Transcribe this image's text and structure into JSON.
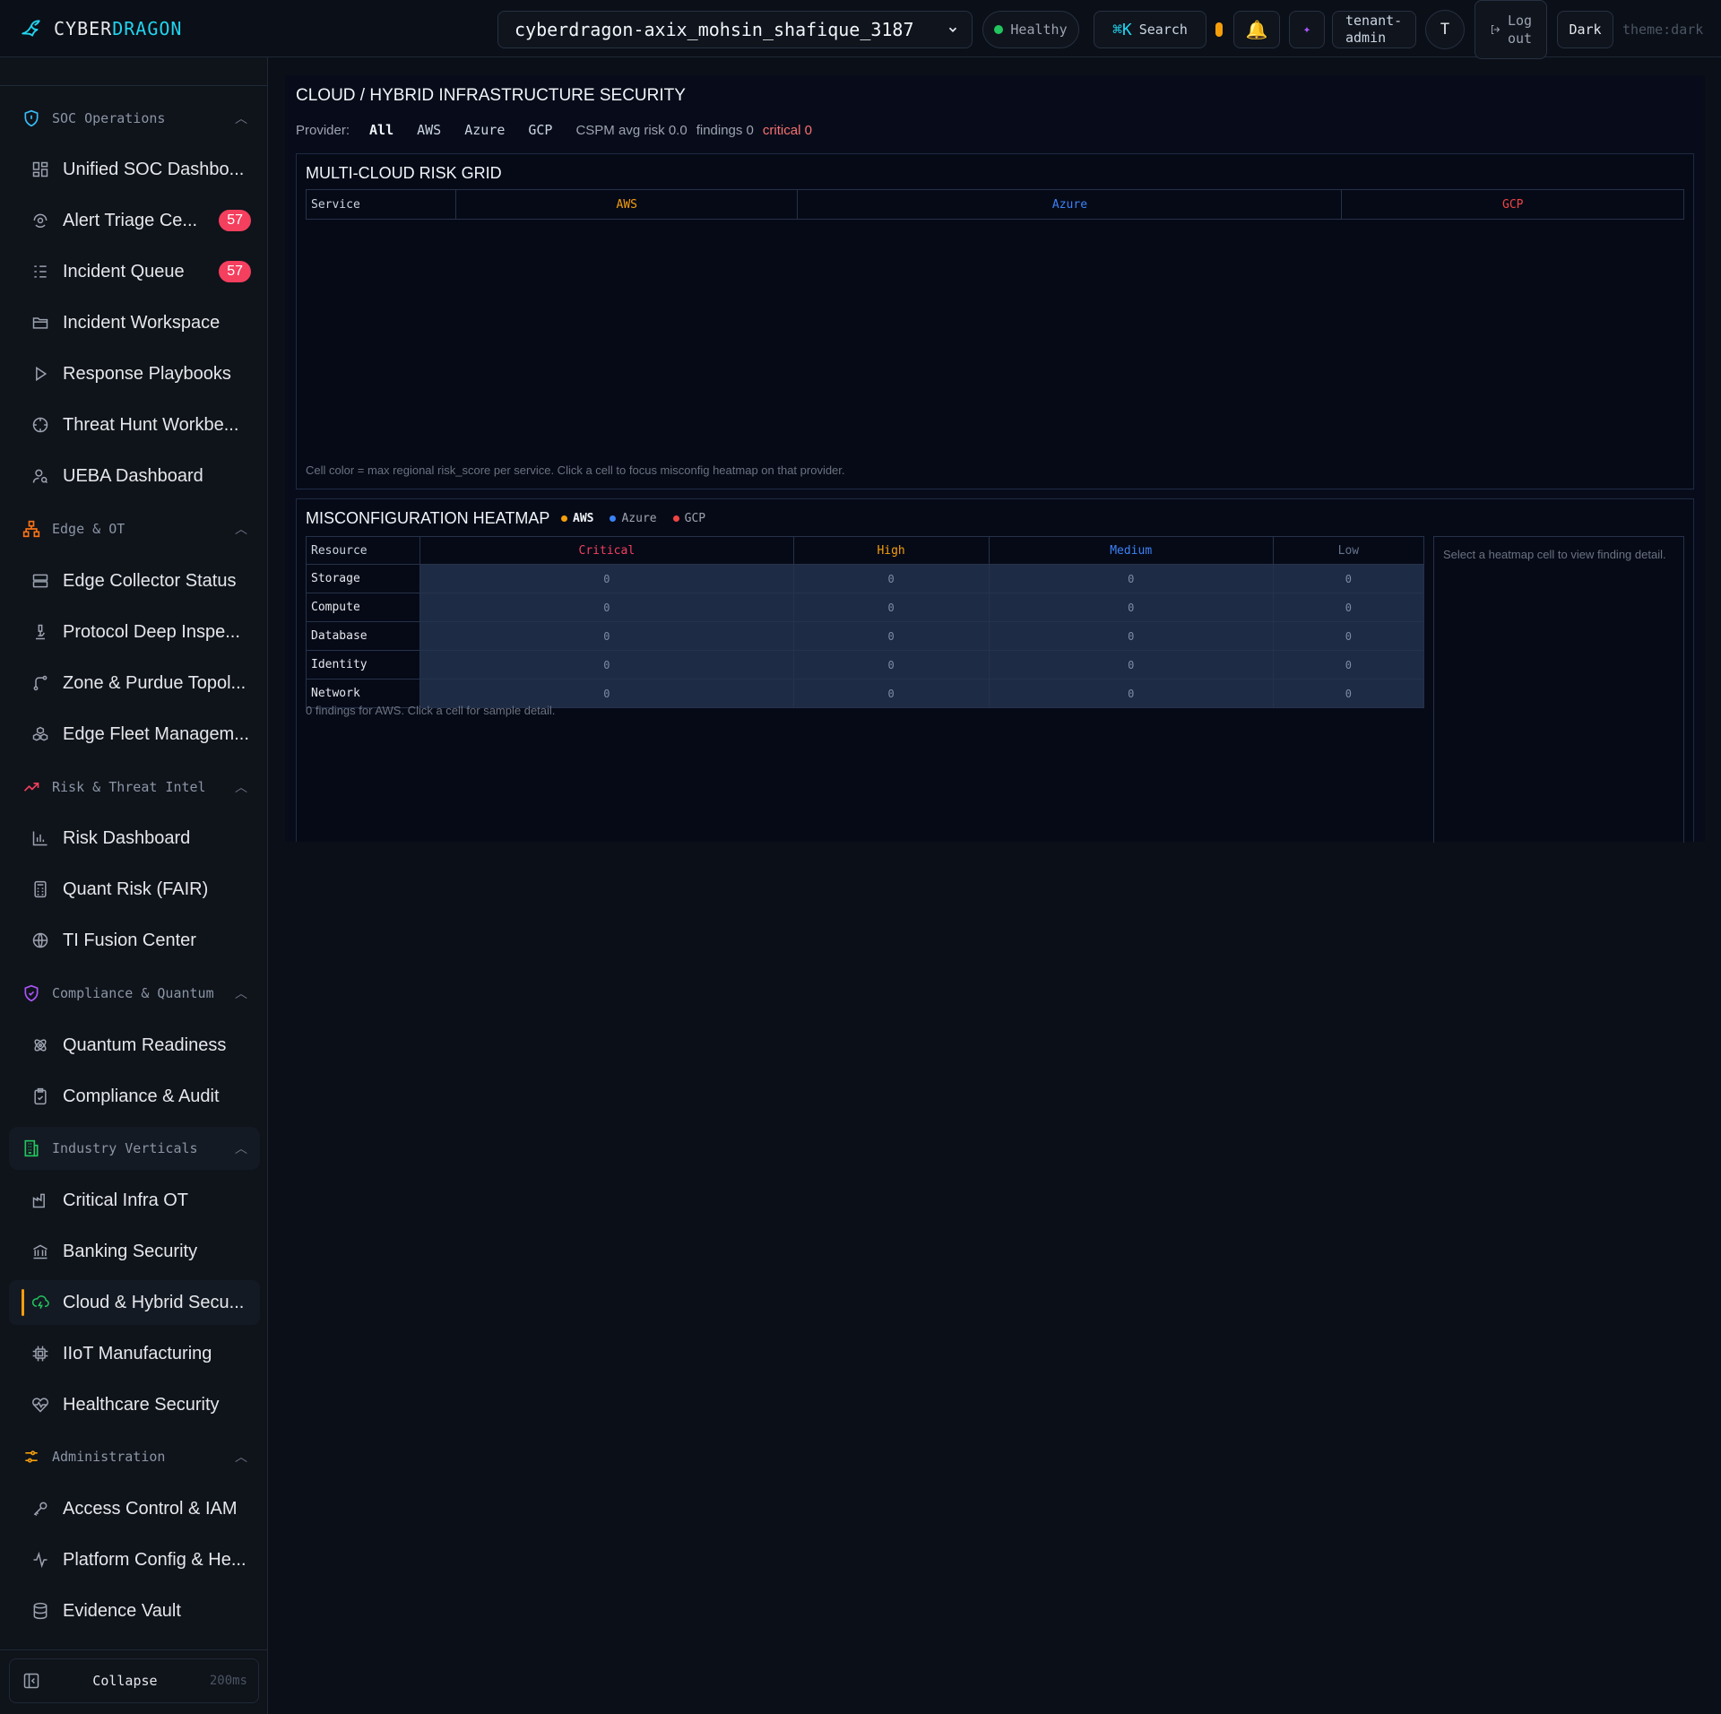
{
  "brand": {
    "part1": "CYBER",
    "part2": "DRAGON"
  },
  "header": {
    "tenant": "cyberdragon-axix_mohsin_shafique_3187",
    "health": "Healthy",
    "search_key": "⌘K",
    "search_label": "Search",
    "role_line1": "tenant-",
    "role_line2": "admin",
    "avatar_initial": "T",
    "logout_line1": "Log",
    "logout_line2": "out",
    "theme_button": "Dark",
    "theme_label": "theme:dark"
  },
  "sidebar": {
    "groups": [
      {
        "label": "SOC Operations",
        "icon": "shield-icon",
        "color": "#38bdf8"
      },
      {
        "label": "Edge & OT",
        "icon": "network-nodes-icon",
        "color": "#f97316"
      },
      {
        "label": "Risk & Threat Intel",
        "icon": "trend-up-icon",
        "color": "#f43f5e"
      },
      {
        "label": "Compliance & Quantum",
        "icon": "shield-check-icon",
        "color": "#a855f7"
      },
      {
        "label": "Industry Verticals",
        "icon": "building-icon",
        "color": "#22c55e"
      },
      {
        "label": "Administration",
        "icon": "sliders-icon",
        "color": "#f59e0b"
      }
    ],
    "items": [
      {
        "label": "Unified SOC Dashbo...",
        "icon": "grid-icon"
      },
      {
        "label": "Alert Triage Ce...",
        "icon": "radar-icon",
        "badge": "57"
      },
      {
        "label": "Incident Queue",
        "icon": "list-icon",
        "badge": "57"
      },
      {
        "label": "Incident Workspace",
        "icon": "folder-icon"
      },
      {
        "label": "Response Playbooks",
        "icon": "play-icon"
      },
      {
        "label": "Threat Hunt Workbe...",
        "icon": "crosshair-icon"
      },
      {
        "label": "UEBA Dashboard",
        "icon": "user-search-icon"
      },
      {
        "label": "Edge Collector Status",
        "icon": "server-icon"
      },
      {
        "label": "Protocol Deep Inspe...",
        "icon": "microscope-icon"
      },
      {
        "label": "Zone & Purdue Topol...",
        "icon": "git-branch-icon"
      },
      {
        "label": "Edge Fleet Managem...",
        "icon": "boxes-icon"
      },
      {
        "label": "Risk Dashboard",
        "icon": "bar-chart-icon"
      },
      {
        "label": "Quant Risk (FAIR)",
        "icon": "calculator-icon"
      },
      {
        "label": "TI Fusion Center",
        "icon": "globe-icon"
      },
      {
        "label": "Quantum Readiness",
        "icon": "atom-icon"
      },
      {
        "label": "Compliance & Audit",
        "icon": "clipboard-check-icon"
      },
      {
        "label": "Critical Infra OT",
        "icon": "factory-icon"
      },
      {
        "label": "Banking Security",
        "icon": "bank-icon"
      },
      {
        "label": "Cloud & Hybrid Secu...",
        "icon": "cloud-lightning-icon"
      },
      {
        "label": "IIoT Manufacturing",
        "icon": "cpu-icon"
      },
      {
        "label": "Healthcare Security",
        "icon": "heart-pulse-icon"
      },
      {
        "label": "Access Control & IAM",
        "icon": "key-icon"
      },
      {
        "label": "Platform Config & He...",
        "icon": "activity-icon"
      },
      {
        "label": "Evidence Vault",
        "icon": "database-icon"
      }
    ],
    "collapse_label": "Collapse",
    "collapse_ms": "200ms"
  },
  "page": {
    "title": "CLOUD / HYBRID INFRASTRUCTURE SECURITY",
    "provider_label": "Provider:",
    "providers": [
      "All",
      "AWS",
      "Azure",
      "GCP"
    ],
    "stats": {
      "avg": "CSPM avg risk 0.0",
      "findings": "findings 0",
      "critical": "critical 0"
    }
  },
  "risk_grid": {
    "title": "MULTI-CLOUD RISK GRID",
    "service_header": "Service",
    "providers": [
      {
        "name": "AWS",
        "color": "#f59e0b"
      },
      {
        "name": "Azure",
        "color": "#3b82f6"
      },
      {
        "name": "GCP",
        "color": "#ef4444"
      }
    ],
    "note": "Cell color = max regional risk_score per service. Click a cell to focus misconfig heatmap on that provider."
  },
  "heatmap": {
    "title": "MISCONFIGURATION HEATMAP",
    "legend": [
      {
        "name": "AWS",
        "color": "#f59e0b"
      },
      {
        "name": "Azure",
        "color": "#3b82f6"
      },
      {
        "name": "GCP",
        "color": "#ef4444"
      }
    ],
    "resource_header": "Resource",
    "severities": [
      {
        "name": "Critical",
        "color": "#f43f5e"
      },
      {
        "name": "High",
        "color": "#f59e0b"
      },
      {
        "name": "Medium",
        "color": "#3b82f6"
      },
      {
        "name": "Low",
        "color": "#64748b"
      }
    ],
    "rows": [
      {
        "name": "Storage",
        "values": [
          "0",
          "0",
          "0",
          "0"
        ]
      },
      {
        "name": "Compute",
        "values": [
          "0",
          "0",
          "0",
          "0"
        ]
      },
      {
        "name": "Database",
        "values": [
          "0",
          "0",
          "0",
          "0"
        ]
      },
      {
        "name": "Identity",
        "values": [
          "0",
          "0",
          "0",
          "0"
        ]
      },
      {
        "name": "Network",
        "values": [
          "0",
          "0",
          "0",
          "0"
        ]
      }
    ],
    "note": "0 findings for AWS. Click a cell for sample detail.",
    "detail_placeholder": "Select a heatmap cell to view finding detail."
  }
}
